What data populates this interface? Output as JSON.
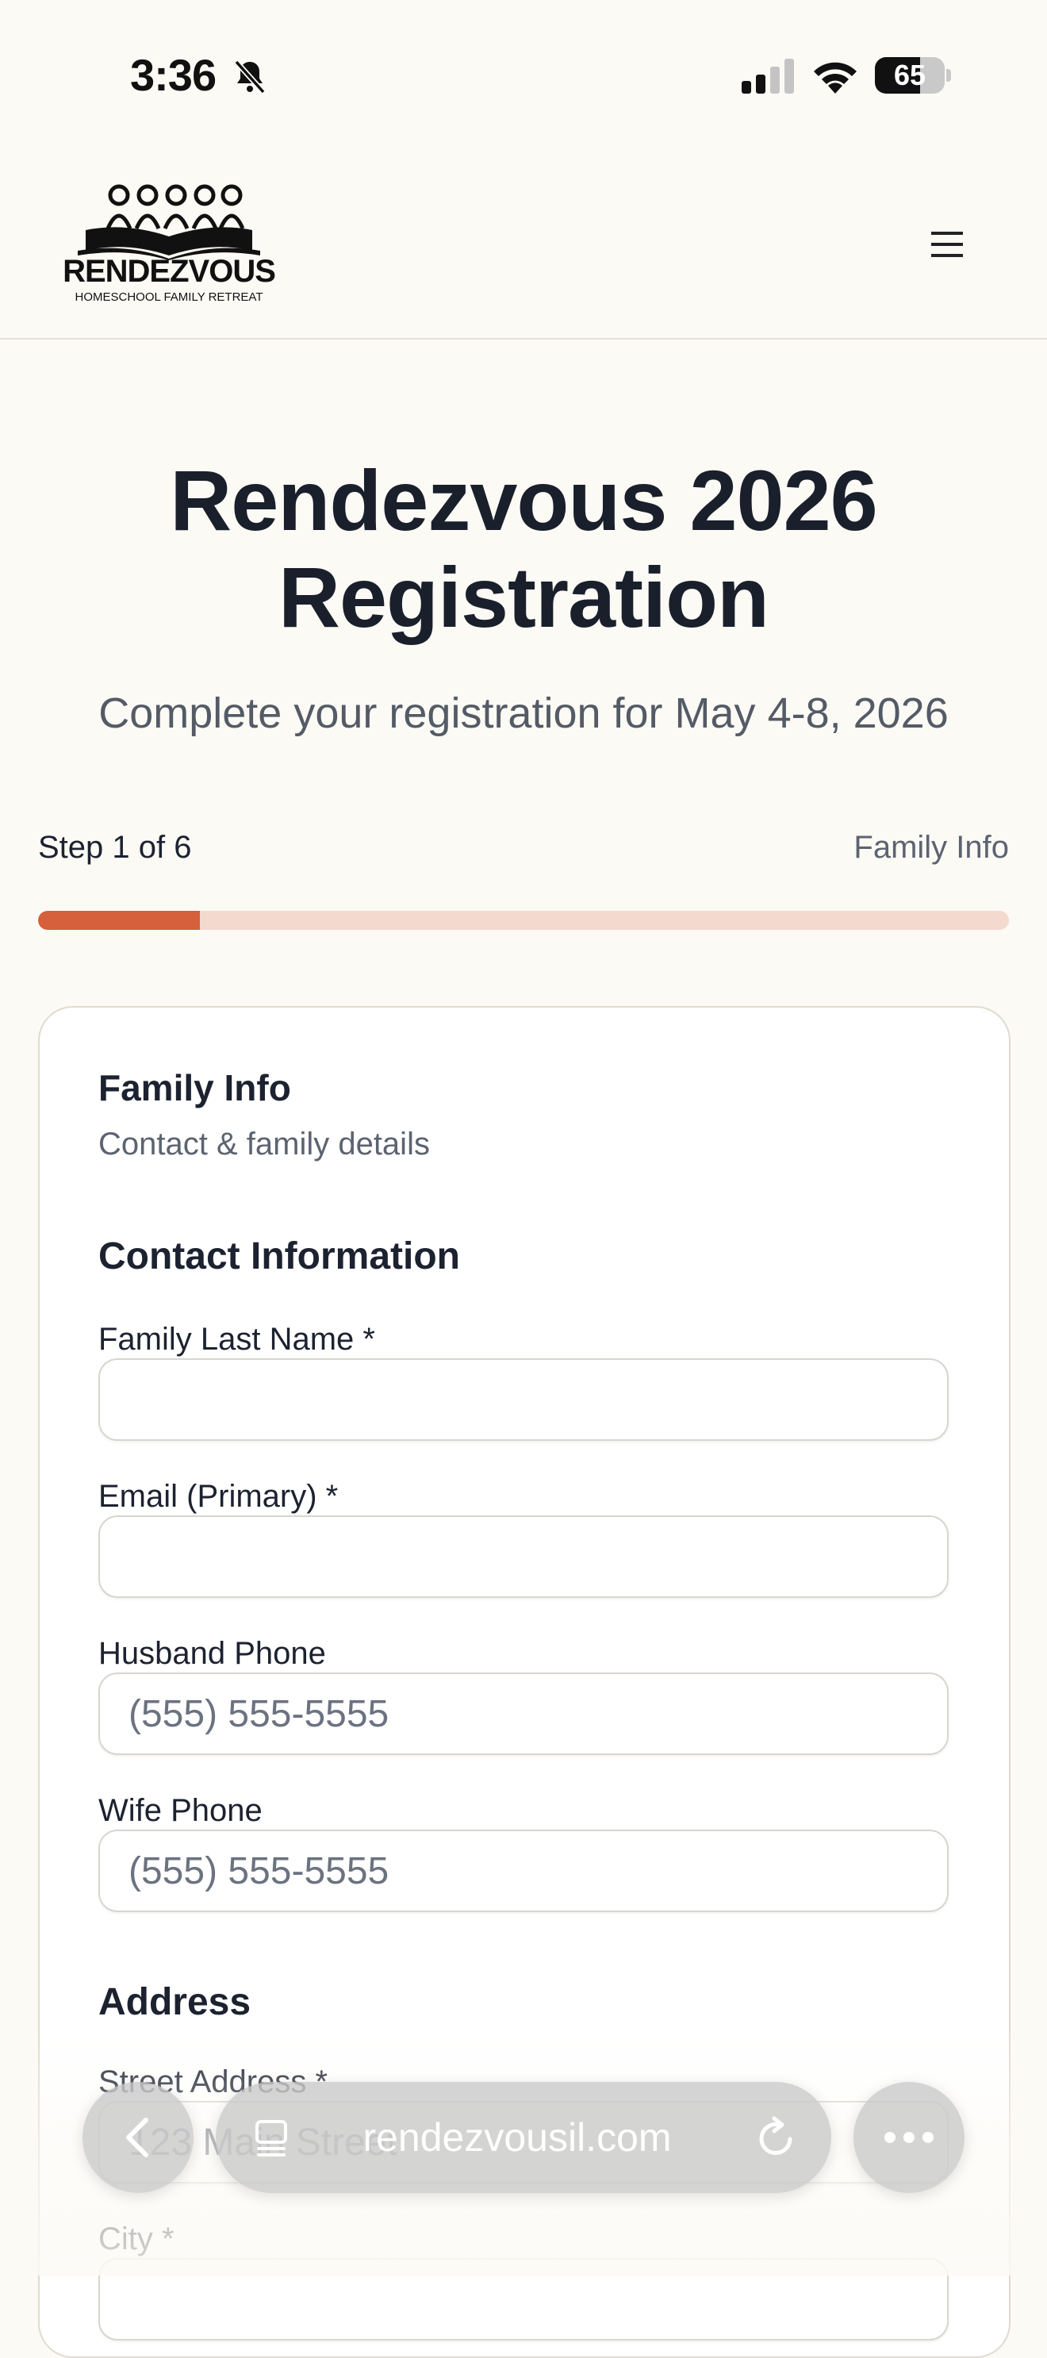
{
  "status_bar": {
    "time": "3:36",
    "battery_level": "65",
    "battery_fraction": 0.65
  },
  "header": {
    "logo_title": "RENDEZVOUS",
    "logo_subtitle": "HOMESCHOOL FAMILY RETREAT",
    "menu_icon": "☰"
  },
  "hero": {
    "title": "Rendezvous 2026 Registration",
    "subtitle": "Complete your registration for May 4-8, 2026"
  },
  "progress": {
    "step_label": "Step 1 of 6",
    "step_name": "Family Info",
    "fraction": 0.1667,
    "fill_color": "#d65f3c",
    "track_color": "#f4d9cf"
  },
  "form": {
    "title": "Family Info",
    "subtitle": "Contact & family details",
    "contact_heading": "Contact Information",
    "fields": {
      "last_name": {
        "label": "Family Last Name *",
        "value": "",
        "placeholder": ""
      },
      "email": {
        "label": "Email (Primary) *",
        "value": "",
        "placeholder": ""
      },
      "husband_phone": {
        "label": "Husband Phone",
        "value": "",
        "placeholder": "(555) 555-5555"
      },
      "wife_phone": {
        "label": "Wife Phone",
        "value": "",
        "placeholder": "(555) 555-5555"
      },
      "street": {
        "label": "Street Address *",
        "value": "",
        "placeholder": "123 Main Street"
      },
      "city": {
        "label": "City *",
        "value": "",
        "placeholder": ""
      }
    },
    "address_heading": "Address"
  },
  "browser": {
    "url": "rendezvousil.com"
  }
}
